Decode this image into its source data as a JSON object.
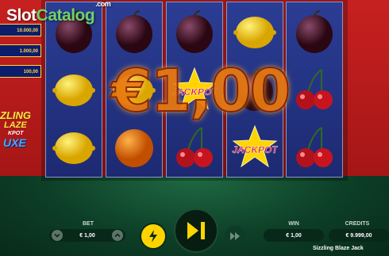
{
  "watermark": {
    "slot": "Slot",
    "catalog": "Catalog",
    "com": ".com"
  },
  "jackpots": [
    "10.000,00",
    "1.000,00",
    "100,00"
  ],
  "game_logo": {
    "line1": "ZLING",
    "line2": "LAZE",
    "line3": "KPOT",
    "line4": "UXE"
  },
  "reels": [
    [
      "plum",
      "lemon",
      "lemon"
    ],
    [
      "plum",
      "lemon",
      "orange"
    ],
    [
      "plum",
      "jackpot",
      "cherry"
    ],
    [
      "lemon",
      "plum",
      "jackpot"
    ],
    [
      "plum",
      "cherry",
      "cherry"
    ]
  ],
  "jackpot_symbol_text": "JACKPOT",
  "win_overlay": "€1,00",
  "bet": {
    "label": "BET",
    "value": "€ 1,00",
    "decrease_icon": "chevron-down-icon",
    "increase_icon": "chevron-up-icon"
  },
  "controls": {
    "turbo_icon": "lightning-icon",
    "spin_icon": "play-pause-icon",
    "autoplay_icon": "fast-forward-icon"
  },
  "win": {
    "label": "WIN",
    "value": "€ 1,00"
  },
  "credits": {
    "label": "CREDITS",
    "value": "€ 9.999,00"
  },
  "game_title": "Sizzling Blaze Jack",
  "colors": {
    "background_top": "#c72020",
    "background_bottom": "#0d3f27",
    "reel": "#2b3d94",
    "accent": "#ffd400"
  }
}
